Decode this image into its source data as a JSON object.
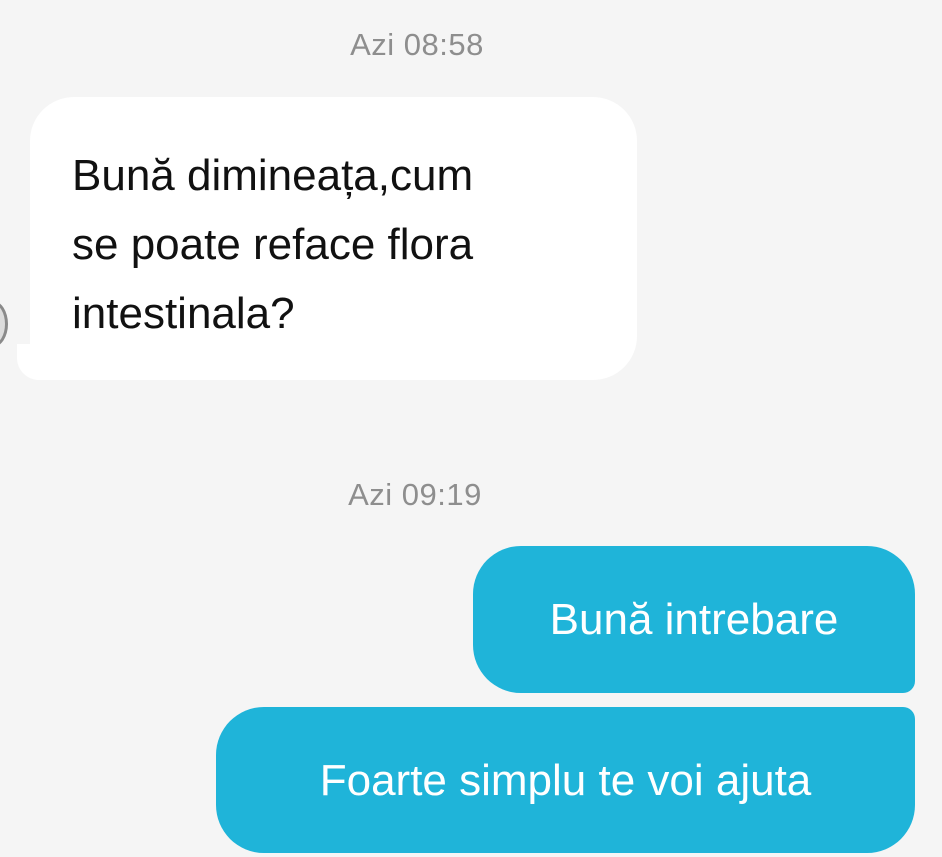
{
  "conversation": {
    "messages": [
      {
        "timestamp": "Azi 08:58",
        "direction": "incoming",
        "text": "Bună dimineața,cum\nse poate reface flora\nintestinala?"
      },
      {
        "timestamp": "Azi 09:19",
        "direction": "outgoing",
        "text": "Bună intrebare"
      },
      {
        "direction": "outgoing",
        "text": "Foarte simplu te voi ajuta"
      }
    ]
  },
  "colors": {
    "background": "#f5f5f5",
    "incoming_bubble": "#ffffff",
    "outgoing_bubble": "#1fb4d9",
    "timestamp_text": "#8e8e8e"
  }
}
